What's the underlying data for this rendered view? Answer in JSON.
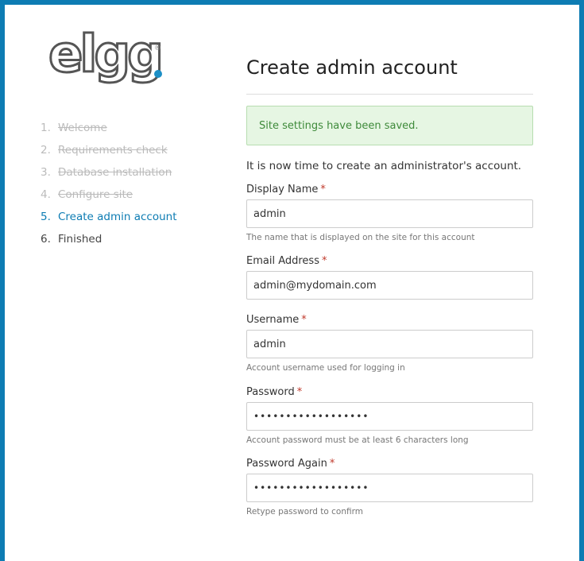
{
  "logo": {
    "text": "elgg",
    "registered": "®"
  },
  "steps": [
    {
      "num": "1.",
      "label": "Welcome"
    },
    {
      "num": "2.",
      "label": "Requirements check"
    },
    {
      "num": "3.",
      "label": "Database installation"
    },
    {
      "num": "4.",
      "label": "Configure site"
    },
    {
      "num": "5.",
      "label": "Create admin account"
    },
    {
      "num": "6.",
      "label": "Finished"
    }
  ],
  "main": {
    "title": "Create admin account",
    "alert": "Site settings have been saved.",
    "intro": "It is now time to create an administrator's account.",
    "required_mark": "*",
    "fields": {
      "display_name": {
        "label": "Display Name",
        "value": "admin",
        "help": "The name that is displayed on the site for this account"
      },
      "email": {
        "label": "Email Address",
        "value": "admin@mydomain.com"
      },
      "username": {
        "label": "Username",
        "value": "admin",
        "help": "Account username used for logging in"
      },
      "password": {
        "label": "Password",
        "value": "••••••••••••••••••",
        "help": "Account password must be at least 6 characters long"
      },
      "password_again": {
        "label": "Password Again",
        "value": "••••••••••••••••••",
        "help": "Retype password to confirm"
      }
    }
  },
  "colors": {
    "background": "#0d7cb3",
    "accent": "#0d7cb3",
    "success_bg": "#e6f6e3",
    "success_text": "#3e8a3a",
    "required": "#c0392b"
  }
}
